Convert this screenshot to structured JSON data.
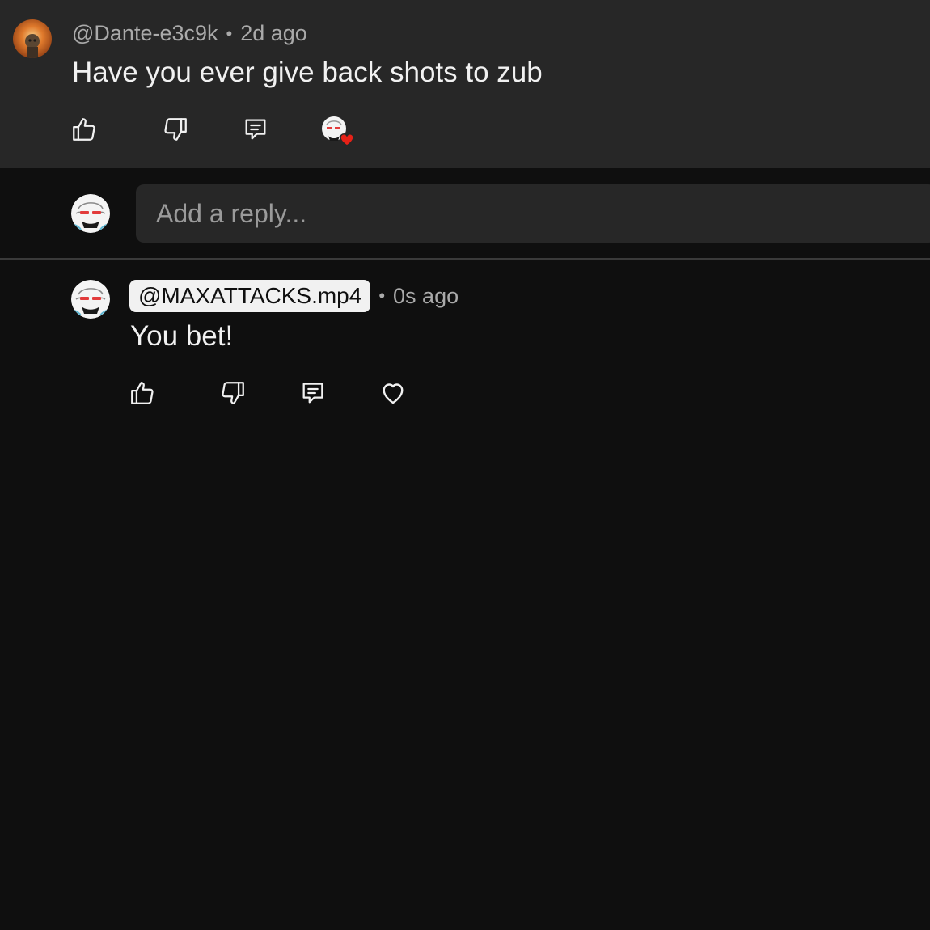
{
  "parent_comment": {
    "author": "@Dante-e3c9k",
    "separator": "•",
    "time": "2d ago",
    "text": "Have you ever give back shots to zub",
    "actions": [
      "like-icon",
      "dislike-icon",
      "reply-icon",
      "creator-heart-icon"
    ]
  },
  "reply_box": {
    "placeholder": "Add a reply..."
  },
  "reply": {
    "author": "@MAXATTACKS.mp4",
    "separator": "•",
    "time": "0s ago",
    "text": "You bet!",
    "actions": [
      "like-icon",
      "dislike-icon",
      "reply-icon",
      "heart-icon"
    ]
  },
  "colors": {
    "background": "#0f0f0f",
    "parent_background": "#272727",
    "heart_red": "#e62117",
    "text": "#f1f1f1",
    "muted": "#aaaaaa"
  }
}
